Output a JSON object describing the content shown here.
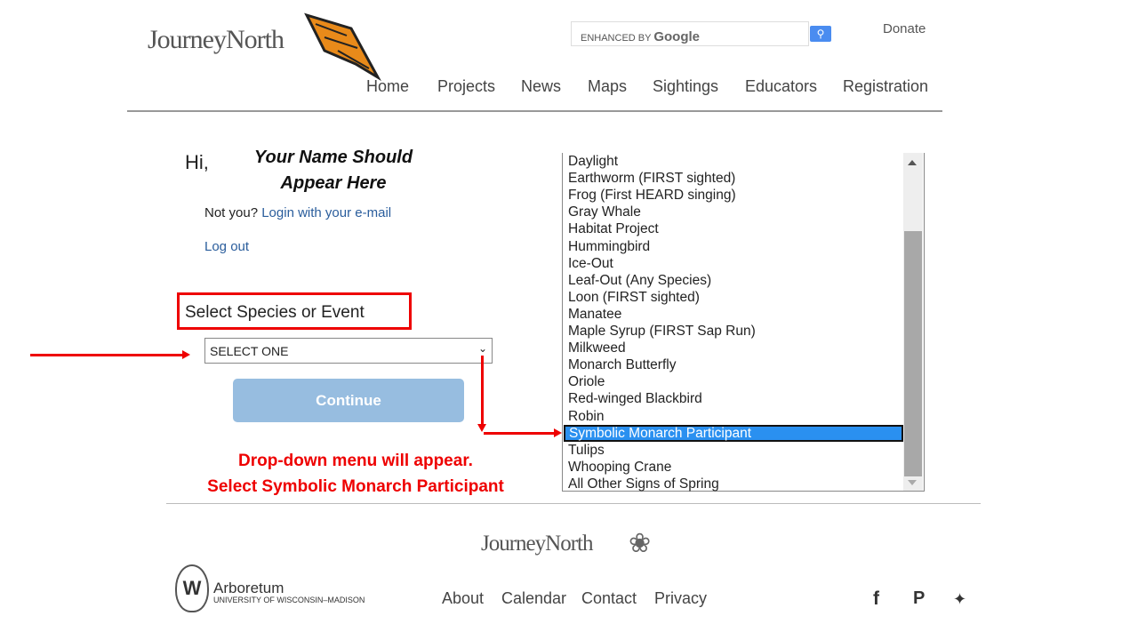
{
  "header": {
    "logo": "JourneyNorth",
    "search_brand_prefix": "ENHANCED BY",
    "search_brand": "Google",
    "donate": "Donate",
    "nav": [
      "Home",
      "Projects",
      "News",
      "Maps",
      "Sightings",
      "Educators",
      "Registration"
    ]
  },
  "greeting": {
    "hi": "Hi,",
    "annotation_line1": "Your Name Should",
    "annotation_line2": "Appear Here",
    "not_you": "Not you?",
    "login_link": "Login with your e-mail",
    "logout": "Log out"
  },
  "form": {
    "label": "Select Species or Event",
    "select_value": "SELECT ONE",
    "continue": "Continue"
  },
  "instruction": {
    "line1": "Drop-down menu will appear.",
    "line2": "Select Symbolic Monarch Participant"
  },
  "dropdown": {
    "items": [
      "Daylight",
      "Earthworm (FIRST sighted)",
      "Frog (First HEARD singing)",
      "Gray Whale",
      "Habitat Project",
      "Hummingbird",
      "Ice-Out",
      "Leaf-Out (Any Species)",
      "Loon (FIRST sighted)",
      "Manatee",
      "Maple Syrup (FIRST Sap Run)",
      "Milkweed",
      "Monarch Butterfly",
      "Oriole",
      "Red-winged Blackbird",
      "Robin",
      "Symbolic Monarch Participant",
      "Tulips",
      "Whooping Crane",
      "All Other Signs of Spring"
    ],
    "selected": "Symbolic Monarch Participant"
  },
  "footer": {
    "logo": "JourneyNorth",
    "arboretum": "Arboretum",
    "university": "UNIVERSITY OF WISCONSIN–MADISON",
    "links": [
      "About",
      "Calendar",
      "Contact",
      "Privacy"
    ],
    "social": [
      "facebook-icon",
      "pinterest-icon",
      "twitter-icon"
    ]
  },
  "colors": {
    "accent_red": "#e00000",
    "highlight": "#2a90f0",
    "continue_button": "#97bde0",
    "link": "#2a5d9c"
  }
}
